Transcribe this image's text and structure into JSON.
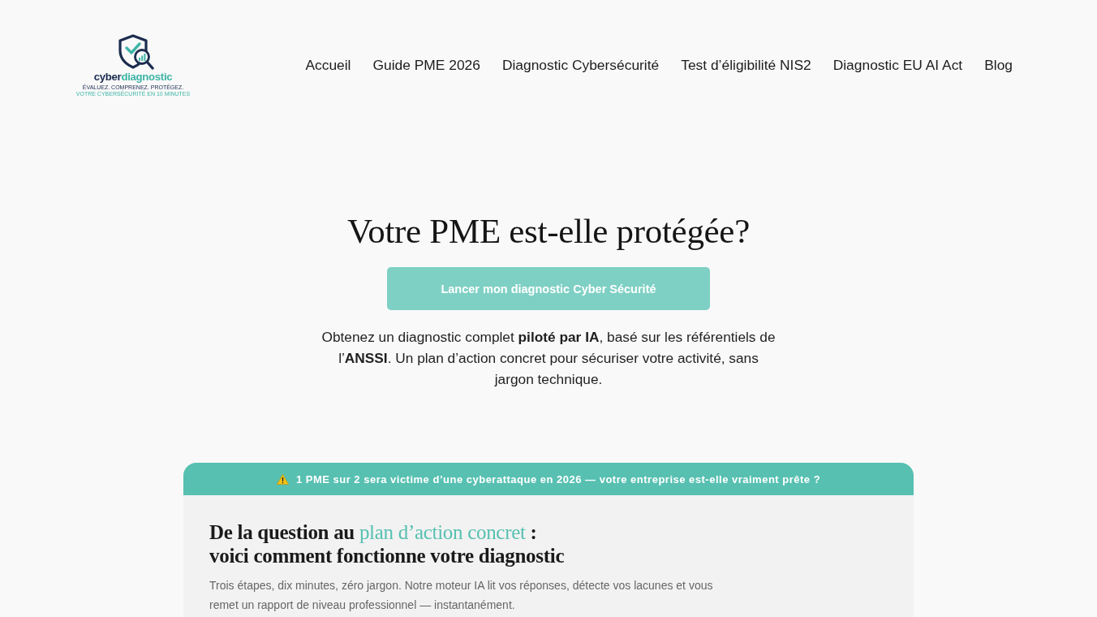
{
  "header": {
    "logo": {
      "wordmark_dark": "cyber",
      "wordmark_accent": "diagnostic",
      "tagline": [
        "ÉVALUEZ. COMPRENEZ. PROTÉGEZ.",
        "VOTRE CYBERSÉCURITÉ EN 10 MINUTES"
      ]
    },
    "nav": [
      {
        "label": "Accueil"
      },
      {
        "label": "Guide PME 2026"
      },
      {
        "label": "Diagnostic Cybersécurité"
      },
      {
        "label": "Test d’éligibilité NIS2"
      },
      {
        "label": "Diagnostic EU AI Act"
      },
      {
        "label": "Blog"
      }
    ]
  },
  "hero": {
    "title": "Votre PME est-elle protégée?",
    "cta": "Lancer mon diagnostic Cyber Sécurité",
    "text": "Obtenez un diagnostic complet **piloté par IA**, basé sur les référentiels de l’**ANSSI**. Un plan d’action concret pour sécuriser votre activité, sans jargon technique."
  },
  "steps_card": {
    "banner": "1 PME sur 2 sera victime d’une cyberattaque en 2026 — votre entreprise est-elle vraiment prête ?",
    "heading": [
      [
        {
          "text": "De la question au ",
          "accent": false
        },
        {
          "text": "plan d’action concret",
          "accent": true
        },
        {
          "text": " :",
          "accent": false
        }
      ],
      [
        {
          "text": "voici comment fonctionne votre diagnostic",
          "accent": false
        }
      ]
    ],
    "description": "Trois étapes, dix minutes, zéro jargon. Notre moteur IA lit vos réponses, détecte vos lacunes et vous remet un rapport de niveau professionnel — instantanément."
  }
}
